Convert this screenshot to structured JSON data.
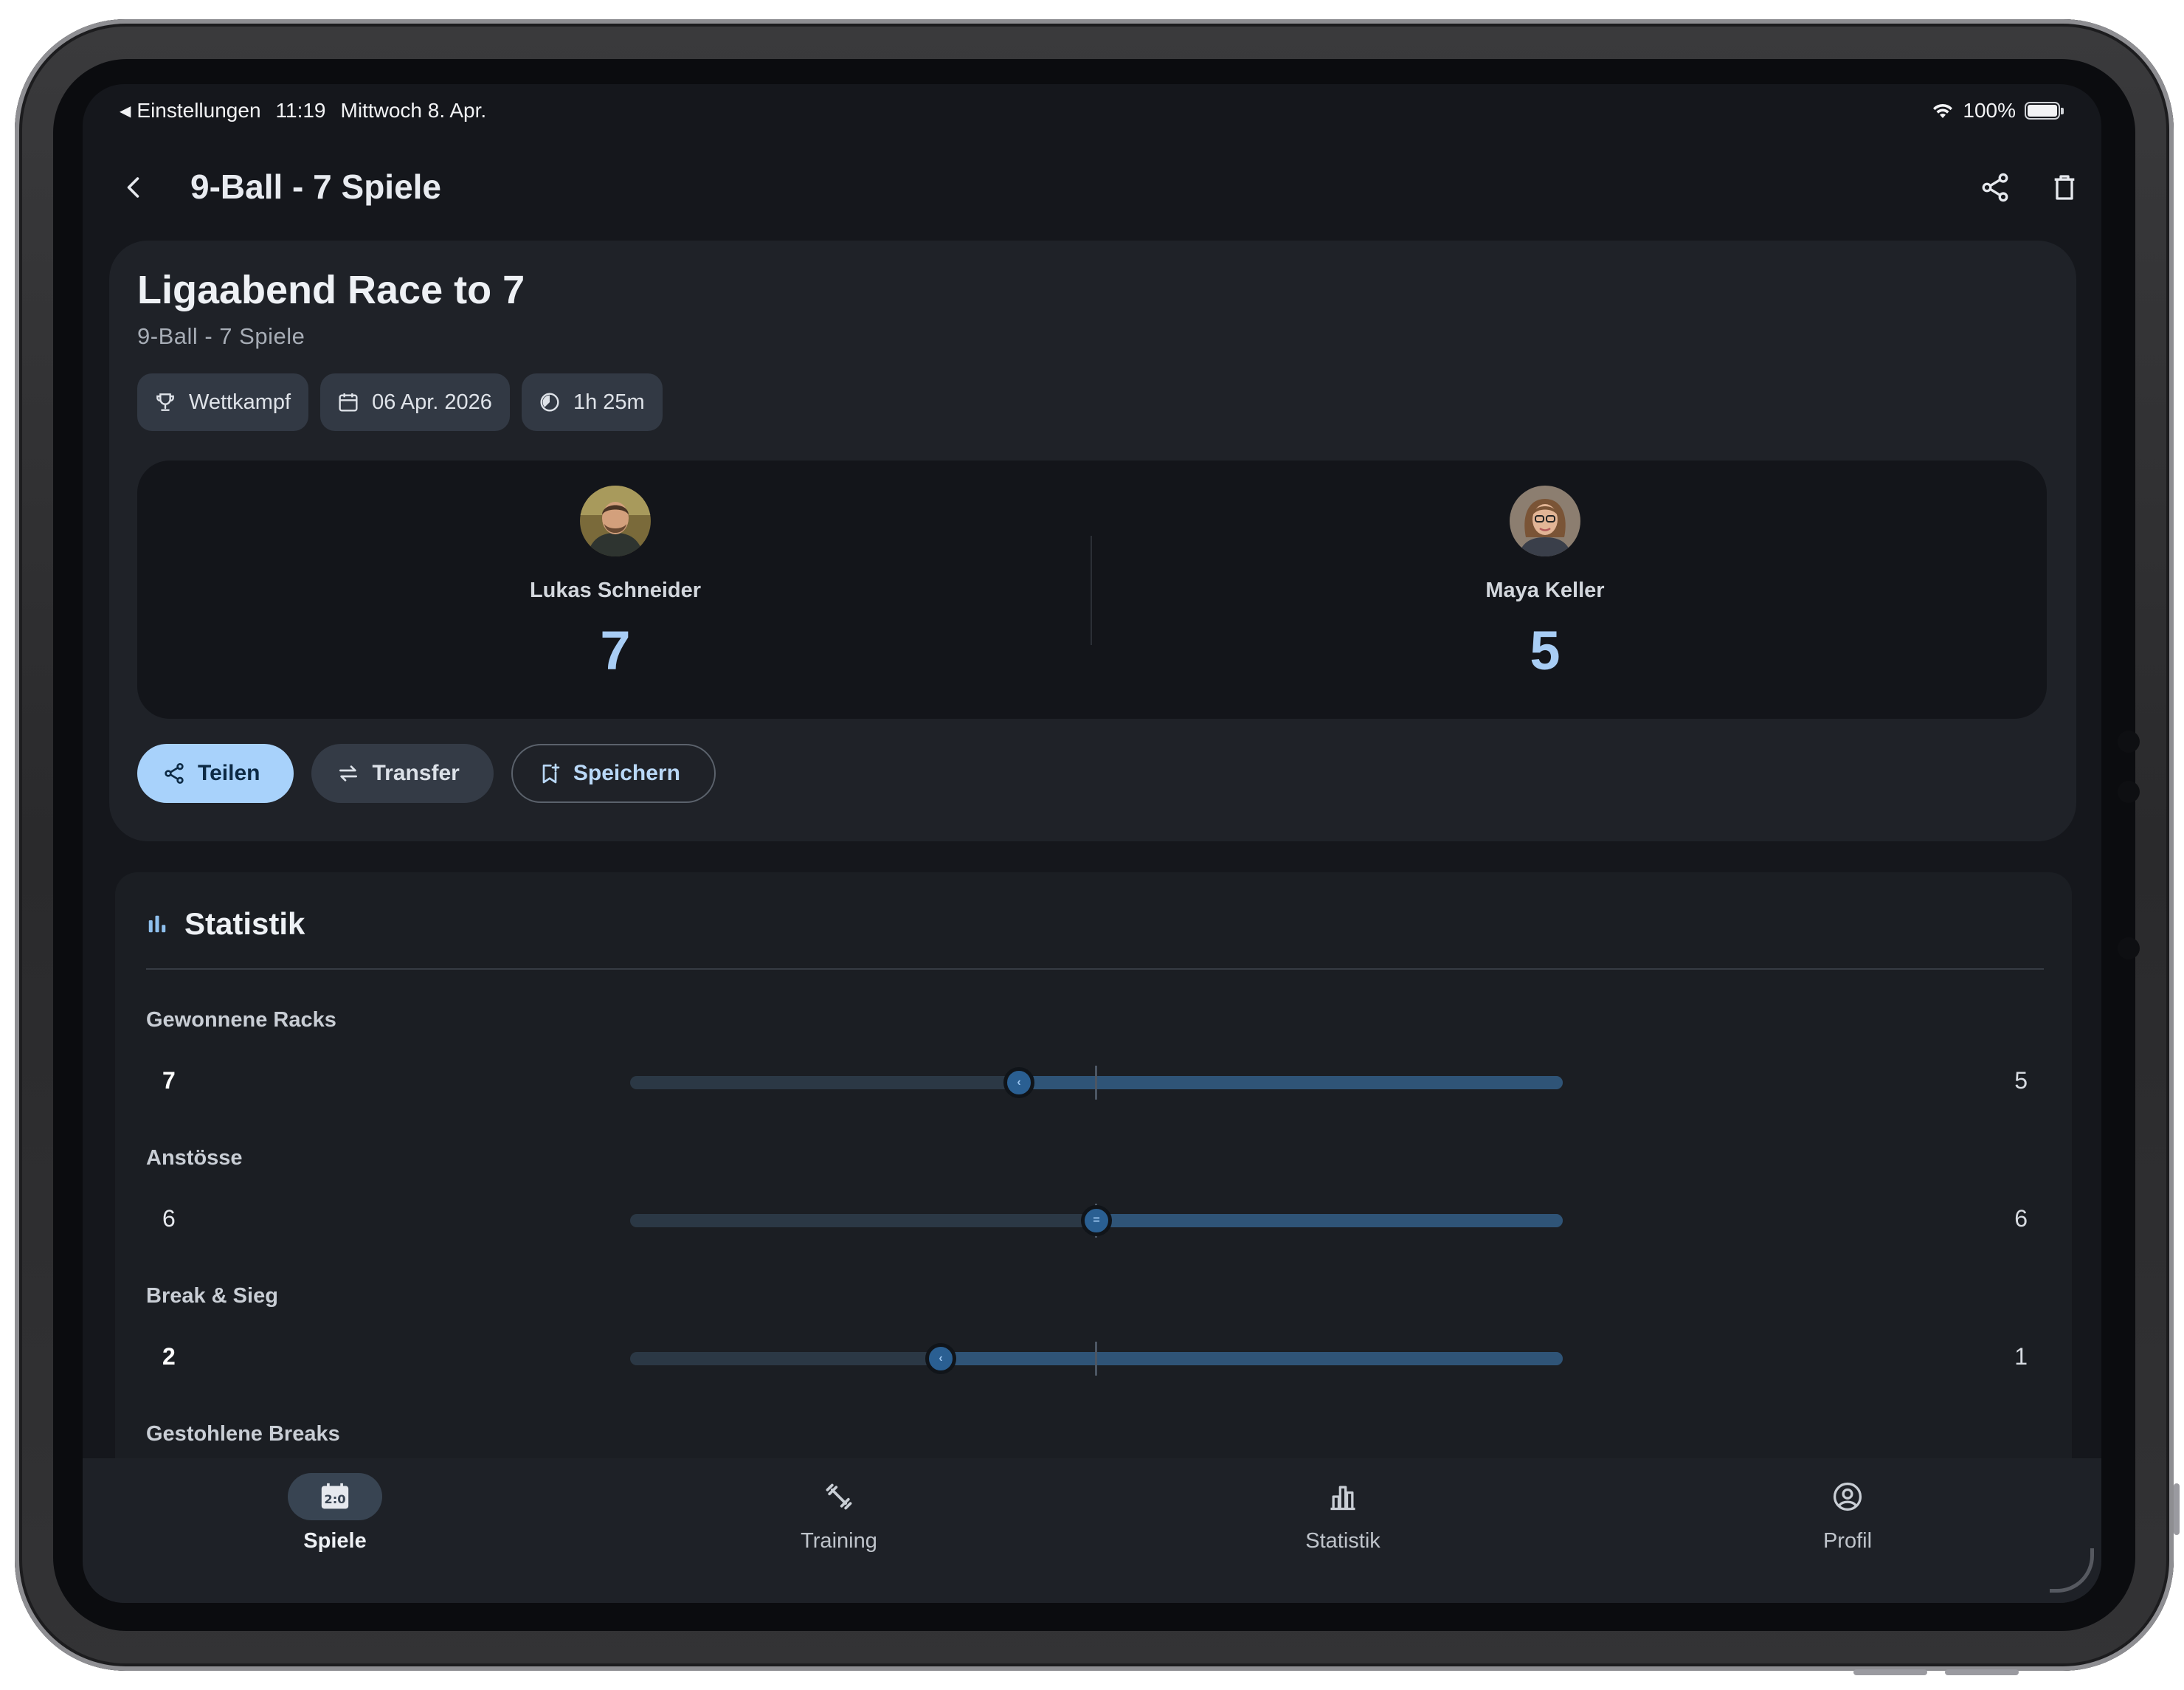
{
  "status": {
    "back_app": "Einstellungen",
    "time": "11:19",
    "date": "Mittwoch 8. Apr.",
    "battery": "100%"
  },
  "appbar": {
    "title": "9-Ball - 7 Spiele",
    "share_icon": "share-icon",
    "delete_icon": "trash-icon"
  },
  "match": {
    "title": "Ligaabend Race to 7",
    "subtitle": "9-Ball - 7 Spiele",
    "chips": [
      {
        "icon": "trophy-icon",
        "label": "Wettkampf"
      },
      {
        "icon": "calendar-icon",
        "label": "06 Apr. 2026"
      },
      {
        "icon": "timer-icon",
        "label": "1h 25m"
      }
    ],
    "players": [
      {
        "name": "Lukas Schneider",
        "score": "7"
      },
      {
        "name": "Maya Keller",
        "score": "5"
      }
    ],
    "buttons": {
      "share": "Teilen",
      "transfer": "Transfer",
      "save": "Speichern"
    }
  },
  "stats": {
    "title": "Statistik",
    "rows": [
      {
        "label": "Gewonnene Racks",
        "left": "7",
        "right": "5",
        "leader": "left",
        "left_share": 0.583
      },
      {
        "label": "Anstösse",
        "left": "6",
        "right": "6",
        "leader": "equal",
        "left_share": 0.5
      },
      {
        "label": "Break & Sieg",
        "left": "2",
        "right": "1",
        "leader": "left",
        "left_share": 0.667
      },
      {
        "label": "Gestohlene Breaks",
        "left": "",
        "right": "",
        "leader": "",
        "left_share": null
      }
    ]
  },
  "nav": [
    {
      "label": "Spiele",
      "icon": "scoreboard-icon",
      "active": true
    },
    {
      "label": "Training",
      "icon": "dumbbell-icon",
      "active": false
    },
    {
      "label": "Statistik",
      "icon": "bar-chart-icon",
      "active": false
    },
    {
      "label": "Profil",
      "icon": "profile-icon",
      "active": false
    }
  ],
  "colors": {
    "accent": "#a8d2fb",
    "score": "#a8cdf5",
    "bar_fill": "#2f5477",
    "bar_track": "#2b3845"
  }
}
